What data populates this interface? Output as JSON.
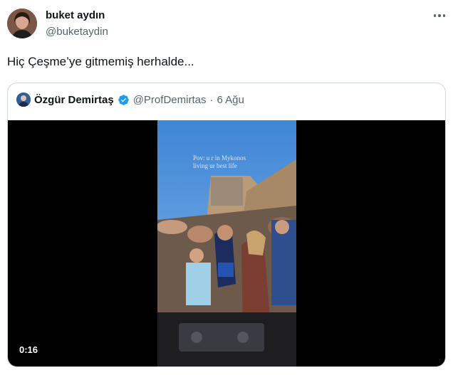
{
  "tweet": {
    "author_name": "buket aydın",
    "author_handle": "@buketaydin",
    "text": "Hiç Çeşme’ye gitmemiş herhalde..."
  },
  "quoted": {
    "author_name": "Özgür Demirtaş",
    "author_handle": "@ProfDemirtas",
    "separator": "·",
    "date": "6 Ağu",
    "verified_color": "#1d9bf0",
    "video": {
      "caption_line1": "Pov: u r in Mykonos",
      "caption_line2": "living ur best life",
      "duration": "0:16"
    }
  },
  "icons": [
    "more-icon",
    "verified-badge-icon"
  ],
  "colors": {
    "text": "#0f1419",
    "secondary": "#536471",
    "border": "#cfd9de",
    "accent": "#1d9bf0"
  }
}
